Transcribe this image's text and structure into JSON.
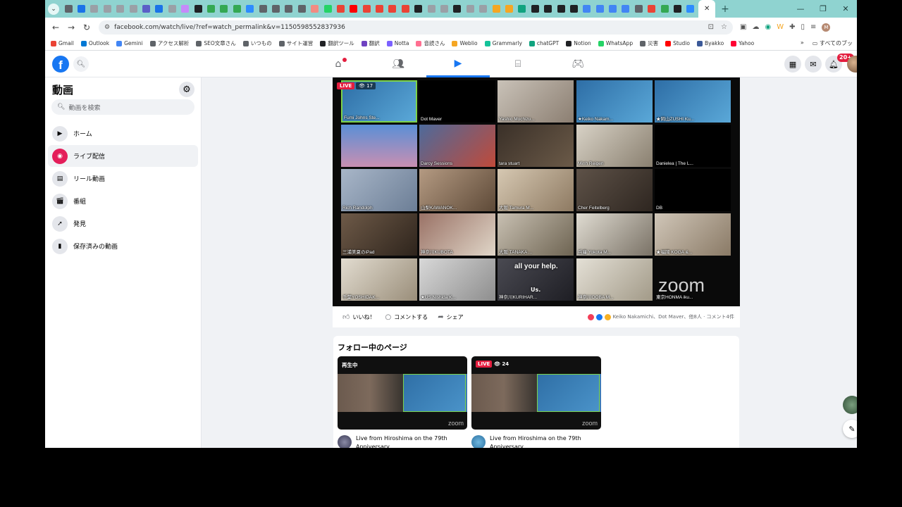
{
  "browser": {
    "url": "facebook.com/watch/live/?ref=watch_permalink&v=1150598552837936",
    "bookmarks": [
      "Gmail",
      "Outlook",
      "Gemini",
      "アクセス解析",
      "SEO文章さん",
      "いつもの",
      "サイト運営",
      "翻訳ツール",
      "翻訳",
      "Notta",
      "音読さん",
      "Weblio",
      "Grammarly",
      "chatGPT",
      "Notion",
      "WhatsApp",
      "災害",
      "Studio",
      "Byakko",
      "Yahoo"
    ],
    "bookmarks_more": "»",
    "all_bookmarks": "すべてのブッ",
    "new_tab": "+"
  },
  "fb": {
    "notif_badge": "20+"
  },
  "sidebar": {
    "title": "動画",
    "search_placeholder": "動画を検索",
    "items": [
      {
        "label": "ホーム"
      },
      {
        "label": "ライブ配信"
      },
      {
        "label": "リール動画"
      },
      {
        "label": "番組"
      },
      {
        "label": "発見"
      },
      {
        "label": "保存済みの動画"
      }
    ]
  },
  "video": {
    "live_label": "LIVE",
    "viewers": "17",
    "caption": "all your help.",
    "caption2": "Us.",
    "zoom_logo": "zoom",
    "participants": [
      "Fumi Johns Ste...",
      "Dot Maver",
      "Yashio Mochizu...",
      "★Keiko Nakam...",
      "★岡山ZUSHI Ku...",
      "",
      "Darcy Sessions",
      "tara stuart",
      "Minh Reigen",
      "Danielea | The L...",
      "Rich Randolph",
      "山梨KAWANOK...",
      "大阪 Tamura M...",
      "Cher Feitelberg",
      "DB",
      "三浦美夏のiPad",
      "神奈川KUBOTA",
      "大阪 TANAKA ...",
      "兵庫 Yokota M...",
      "★福岡 KOGA &...",
      "千葉YOSHIDAK...",
      "★US Nishida K...",
      "神奈川KURIHAR...",
      "神奈川OOBA M...",
      "東京HONMA iku..."
    ]
  },
  "actions": {
    "like": "いいね！",
    "comment": "コメントする",
    "share": "シェア",
    "reaction_text": "Keiko Nakamichi、Dot Maver、他8人 · コメント4件"
  },
  "follow": {
    "title": "フォロー中のページ",
    "videos": [
      {
        "tag": "再生中",
        "title": "Live from Hiroshima on the 79th Anniversary",
        "zoom": "zoom"
      },
      {
        "live": "LIVE",
        "views": "24",
        "title": "Live from Hiroshima on the 79th Anniversary",
        "zoom": "zoom"
      }
    ]
  },
  "colors": {
    "fb_blue": "#1877f2",
    "live_red": "#e41e3f",
    "tab_teal": "#8fd3d0",
    "zoom_highlight": "#7cd34a"
  }
}
